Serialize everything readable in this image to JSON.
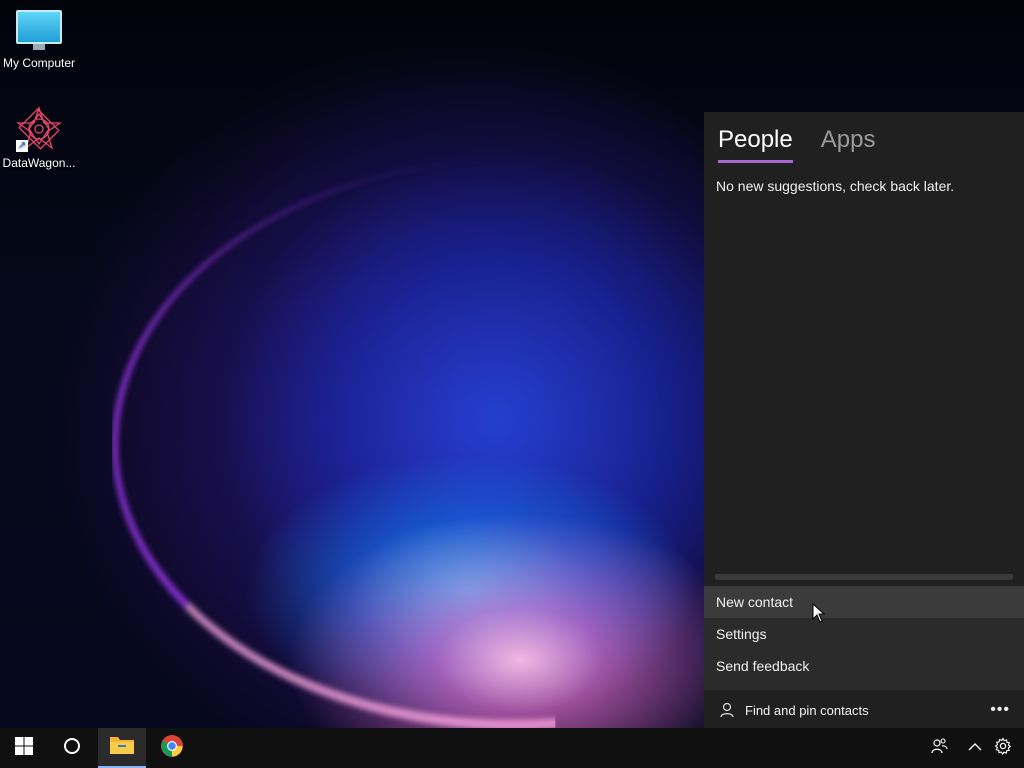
{
  "desktop": {
    "icons": [
      {
        "label": "My Computer",
        "icon": "monitor-icon"
      },
      {
        "label": "DataWagon...",
        "icon": "datawagon-icon"
      }
    ]
  },
  "people_panel": {
    "tabs": [
      {
        "label": "People",
        "active": true
      },
      {
        "label": "Apps",
        "active": false
      }
    ],
    "suggestion_text": "No new suggestions, check back later.",
    "menu": {
      "items": [
        {
          "label": "New contact",
          "hovered": true
        },
        {
          "label": "Settings",
          "hovered": false
        },
        {
          "label": "Send feedback",
          "hovered": false
        }
      ]
    },
    "footer": {
      "label": "Find and pin contacts",
      "more_label": "•••"
    },
    "accent_color": "#a866d1"
  },
  "taskbar": {
    "items": [
      {
        "name": "start-button",
        "icon": "windows-logo-icon"
      },
      {
        "name": "cortana-button",
        "icon": "circle-icon"
      },
      {
        "name": "file-explorer-button",
        "icon": "folder-icon"
      },
      {
        "name": "chrome-button",
        "icon": "chrome-icon"
      }
    ],
    "tray": [
      {
        "name": "people-button",
        "icon": "people-icon"
      },
      {
        "name": "show-hidden-icons-button",
        "icon": "chevron-up-icon"
      },
      {
        "name": "settings-tray-button",
        "icon": "gear-icon"
      }
    ]
  }
}
